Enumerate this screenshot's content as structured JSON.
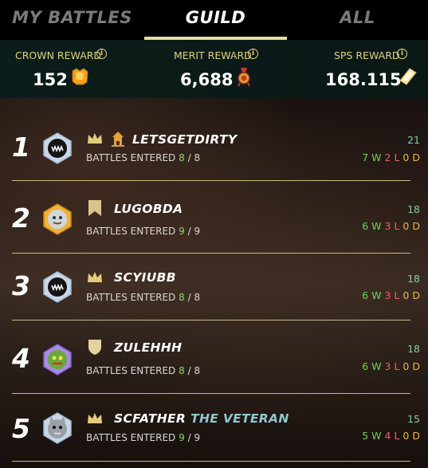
{
  "tabs": [
    {
      "label": "MY BATTLES",
      "active": false
    },
    {
      "label": "GUILD",
      "active": true
    },
    {
      "label": "ALL",
      "active": false
    }
  ],
  "rewards": [
    {
      "label": "CROWN REWARD",
      "value": "152",
      "icon": "crown-token-icon"
    },
    {
      "label": "MERIT REWARD",
      "value": "6,688",
      "icon": "merit-medal-icon"
    },
    {
      "label": "SPS REWARD",
      "value": "168.115",
      "icon": "sps-crystal-icon"
    }
  ],
  "entered_label": "BATTLES ENTERED",
  "wld_letters": {
    "w": "W",
    "l": "L",
    "d": "D"
  },
  "players": [
    {
      "rank": "1",
      "name": "LETSGETDIRTY",
      "title": "",
      "badge": "crown-icon",
      "extra_badge": "tower-icon",
      "avatar": "black-monster-avatar",
      "entered": "8",
      "total": "8",
      "score": "21",
      "wins": "7",
      "losses": "2",
      "draws": "0"
    },
    {
      "rank": "2",
      "name": "LUGOBDA",
      "title": "",
      "badge": "banner-icon",
      "extra_badge": "",
      "avatar": "gold-gizmo-avatar",
      "entered": "9",
      "total": "9",
      "score": "18",
      "wins": "6",
      "losses": "3",
      "draws": "0"
    },
    {
      "rank": "3",
      "name": "SCYIUBB",
      "title": "",
      "badge": "crown-icon",
      "extra_badge": "",
      "avatar": "black-monster-avatar",
      "entered": "8",
      "total": "8",
      "score": "18",
      "wins": "6",
      "losses": "3",
      "draws": "0"
    },
    {
      "rank": "4",
      "name": "ZULEHHH",
      "title": "",
      "badge": "shield-icon",
      "extra_badge": "",
      "avatar": "green-goblin-avatar",
      "entered": "8",
      "total": "8",
      "score": "18",
      "wins": "6",
      "losses": "3",
      "draws": "0"
    },
    {
      "rank": "5",
      "name": "SCFATHER",
      "title": "THE VETERAN",
      "badge": "crown-icon",
      "extra_badge": "",
      "avatar": "grey-cat-avatar",
      "entered": "9",
      "total": "9",
      "score": "15",
      "wins": "5",
      "losses": "4",
      "draws": "0"
    }
  ],
  "colors": {
    "accent": "#e8d9a6",
    "reward_label": "#e6d17a",
    "win": "#6fd35a",
    "loss": "#ef5f5f",
    "draw": "#efb54a"
  }
}
